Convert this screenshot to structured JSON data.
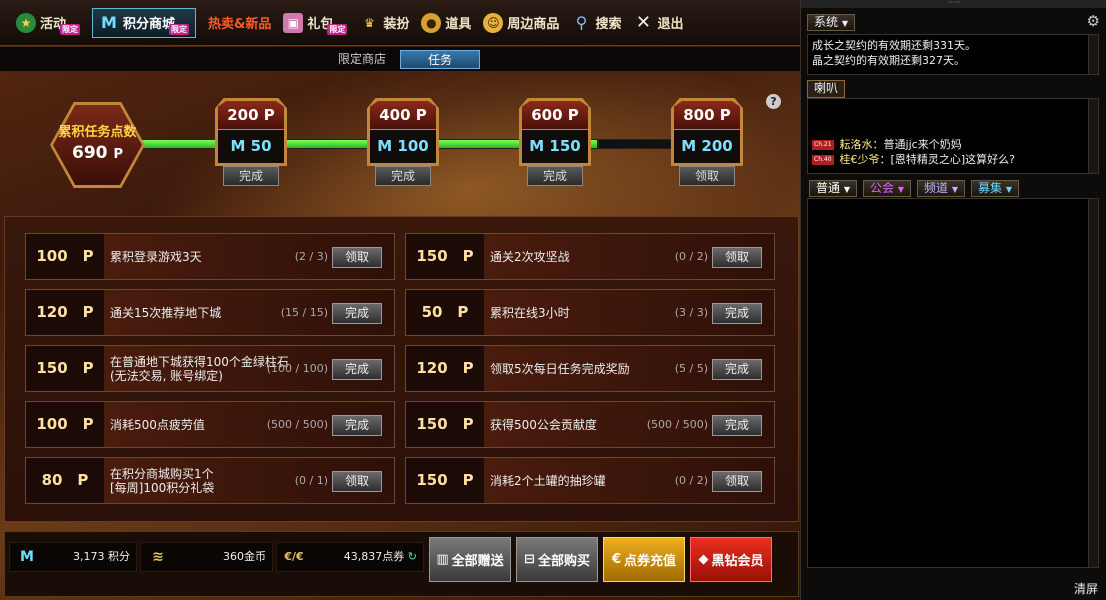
{
  "nav": [
    {
      "label": "活动",
      "tag": "限定",
      "icon": "star-icon"
    },
    {
      "label": "积分商城",
      "tag": "限定",
      "icon": "m-coin-icon",
      "active": true
    },
    {
      "label": "热卖&新品",
      "tag": "",
      "icon": "",
      "hot": true
    },
    {
      "label": "礼包",
      "tag": "限定",
      "icon": "gift-icon"
    },
    {
      "label": "装扮",
      "tag": "",
      "icon": "trophy-icon"
    },
    {
      "label": "道具",
      "tag": "",
      "icon": "item-icon"
    },
    {
      "label": "周边商品",
      "tag": "",
      "icon": "face-icon"
    },
    {
      "label": "搜索",
      "tag": "",
      "icon": "search-icon"
    },
    {
      "label": "退出",
      "tag": "",
      "icon": "close-icon"
    }
  ],
  "subtabs": {
    "shop": "限定商店",
    "tasks": "任务"
  },
  "help": "?",
  "accumulated": {
    "title": "累积任务点数",
    "value": "690",
    "unit": "P"
  },
  "milestones": [
    {
      "points": "200 P",
      "reward": "M 50",
      "button": "完成"
    },
    {
      "points": "400 P",
      "reward": "M 100",
      "button": "完成"
    },
    {
      "points": "600 P",
      "reward": "M 150",
      "button": "完成"
    },
    {
      "points": "800 P",
      "reward": "M 200",
      "button": "领取"
    }
  ],
  "progress_fraction": 0.86,
  "tasks": [
    {
      "points": "100　P",
      "name": "累积登录游戏3天",
      "progress": "(2 / 3)",
      "button": "领取"
    },
    {
      "points": "150　P",
      "name": "通关2次攻坚战",
      "progress": "(0 / 2)",
      "button": "领取"
    },
    {
      "points": "120　P",
      "name": "通关15次推荐地下城",
      "progress": "(15 / 15)",
      "button": "完成"
    },
    {
      "points": "50　P",
      "name": "累积在线3小时",
      "progress": "(3 / 3)",
      "button": "完成"
    },
    {
      "points": "150　P",
      "name": "在普通地下城获得100个金绿柱石\n(无法交易, 账号绑定)",
      "progress": "(100 / 100)",
      "button": "完成"
    },
    {
      "points": "120　P",
      "name": "领取5次每日任务完成奖励",
      "progress": "(5 / 5)",
      "button": "完成"
    },
    {
      "points": "100　P",
      "name": "消耗500点疲劳值",
      "progress": "(500 / 500)",
      "button": "完成"
    },
    {
      "points": "150　P",
      "name": "获得500公会贡献度",
      "progress": "(500 / 500)",
      "button": "完成"
    },
    {
      "points": "80　P",
      "name": "在积分商城购买1个\n[每周]100积分礼袋",
      "progress": "(0 / 1)",
      "button": "领取"
    },
    {
      "points": "150　P",
      "name": "消耗2个土罐的抽珍罐",
      "progress": "(0 / 2)",
      "button": "领取"
    }
  ],
  "currency": {
    "points": {
      "icon": "M",
      "value": "3,173 积分"
    },
    "gold": {
      "value": "360金币"
    },
    "coupon": {
      "value": "43,837点券"
    }
  },
  "bottom_buttons": {
    "gift_all": "全部赠送",
    "buy_all": "全部购买",
    "recharge": "点券充值",
    "vip": "黑钻会员"
  },
  "chat": {
    "system_label": "系统",
    "system_messages": [
      "成长之契约的有效期还剩331天。",
      "晶之契约的有效期还剩327天。"
    ],
    "horn_label": "喇叭",
    "horn_messages": [
      {
        "channel": "Ch.21",
        "name": "耘洛水",
        "text": "：普通jjc来个奶妈"
      },
      {
        "channel": "Ch.40",
        "name": "桂€少爷",
        "text": "：[恩特精灵之心]这算好么?"
      }
    ],
    "tabs": [
      {
        "label": "普通",
        "color": "#ffffff"
      },
      {
        "label": "公会",
        "color": "#e060ff"
      },
      {
        "label": "频道",
        "color": "#c0b4ff"
      },
      {
        "label": "募集",
        "color": "#70d0ff"
      }
    ],
    "clear": "清屏"
  }
}
